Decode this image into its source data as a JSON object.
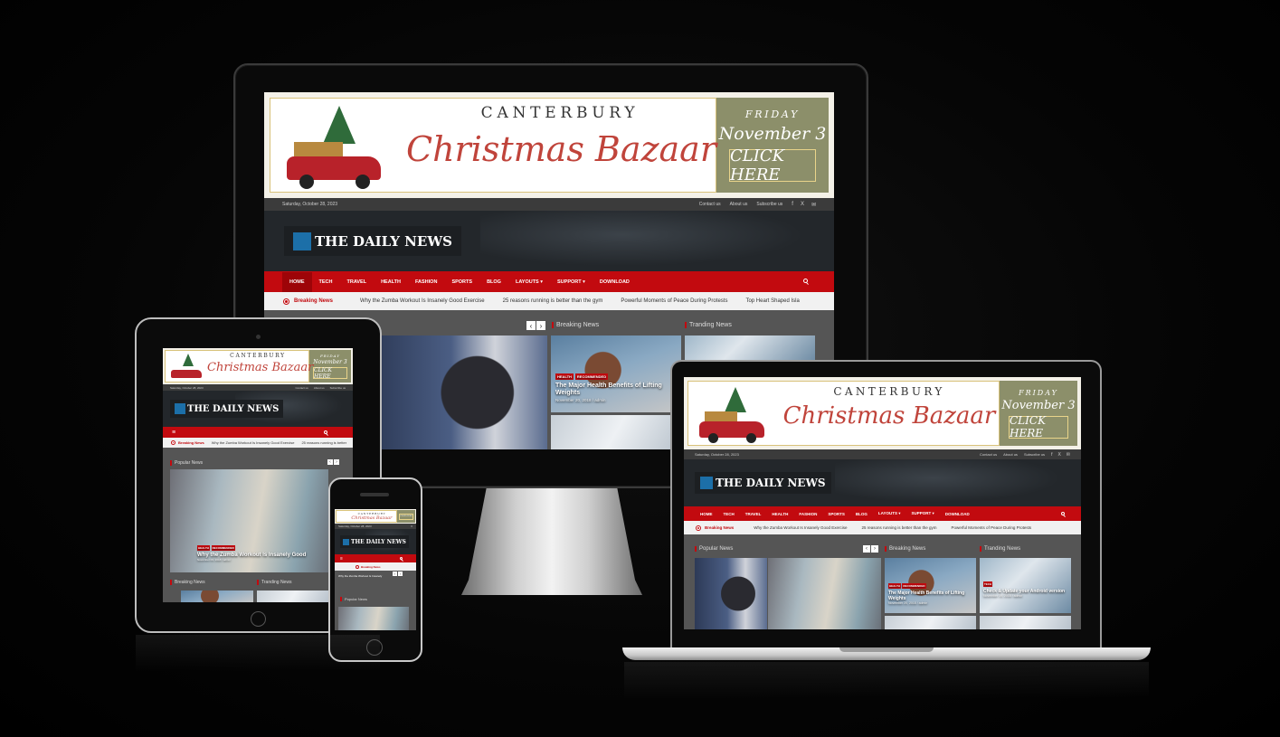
{
  "banner": {
    "title": "CANTERBURY",
    "event": "Christmas Bazaar",
    "day": "FRIDAY",
    "date": "November 3",
    "cta": "CLICK HERE"
  },
  "topbar": {
    "date": "Saturday, October 28, 2023",
    "links": [
      "Contact us",
      "About us",
      "Subscribe us"
    ],
    "social": [
      "f",
      "X",
      "✉"
    ]
  },
  "site": {
    "logo_text": "THE DAILY NEWS"
  },
  "nav": {
    "items": [
      "HOME",
      "TECH",
      "TRAVEL",
      "HEALTH",
      "FASHION",
      "SPORTS",
      "BLOG",
      "LAYOUTS ▾",
      "SUPPORT ▾",
      "DOWNLOAD"
    ],
    "menu_icon": "≡"
  },
  "ticker": {
    "label": "Breaking News",
    "items": [
      "Why the Zumba Workout Is Insanely Good Exercise",
      "25 reasons running is better than the gym",
      "Powerful Moments of Peace During Protests",
      "Top Heart Shaped Isla"
    ]
  },
  "sections": {
    "popular": "Popular News",
    "breaking": "Breaking News",
    "trending": "Tranding News"
  },
  "arrows": {
    "prev": "‹",
    "next": "›"
  },
  "posts": {
    "lifting": {
      "cats": [
        "HEALTH",
        "RECOMMENDED"
      ],
      "title": "The Major Health Benefits of Lifting Weights",
      "meta": "November 20, 2018 / admin"
    },
    "zumba": {
      "cats": [
        "HEALTH",
        "RECOMMENDED"
      ],
      "title": "Why the Zumba Workout Is Insanely Good",
      "meta": "November 09, 2018 / admin"
    },
    "android": {
      "cats": [
        "TECH"
      ],
      "title": "Check & Update your Android version",
      "meta": "November 19, 2018 / admin"
    }
  },
  "tablet_ticker": [
    "Why the Zumba Workout Is Insanely Good Exercise",
    "25 reasons running is better"
  ],
  "phone_ticker": [
    "Why the Zumba Workout Is Insanely"
  ]
}
